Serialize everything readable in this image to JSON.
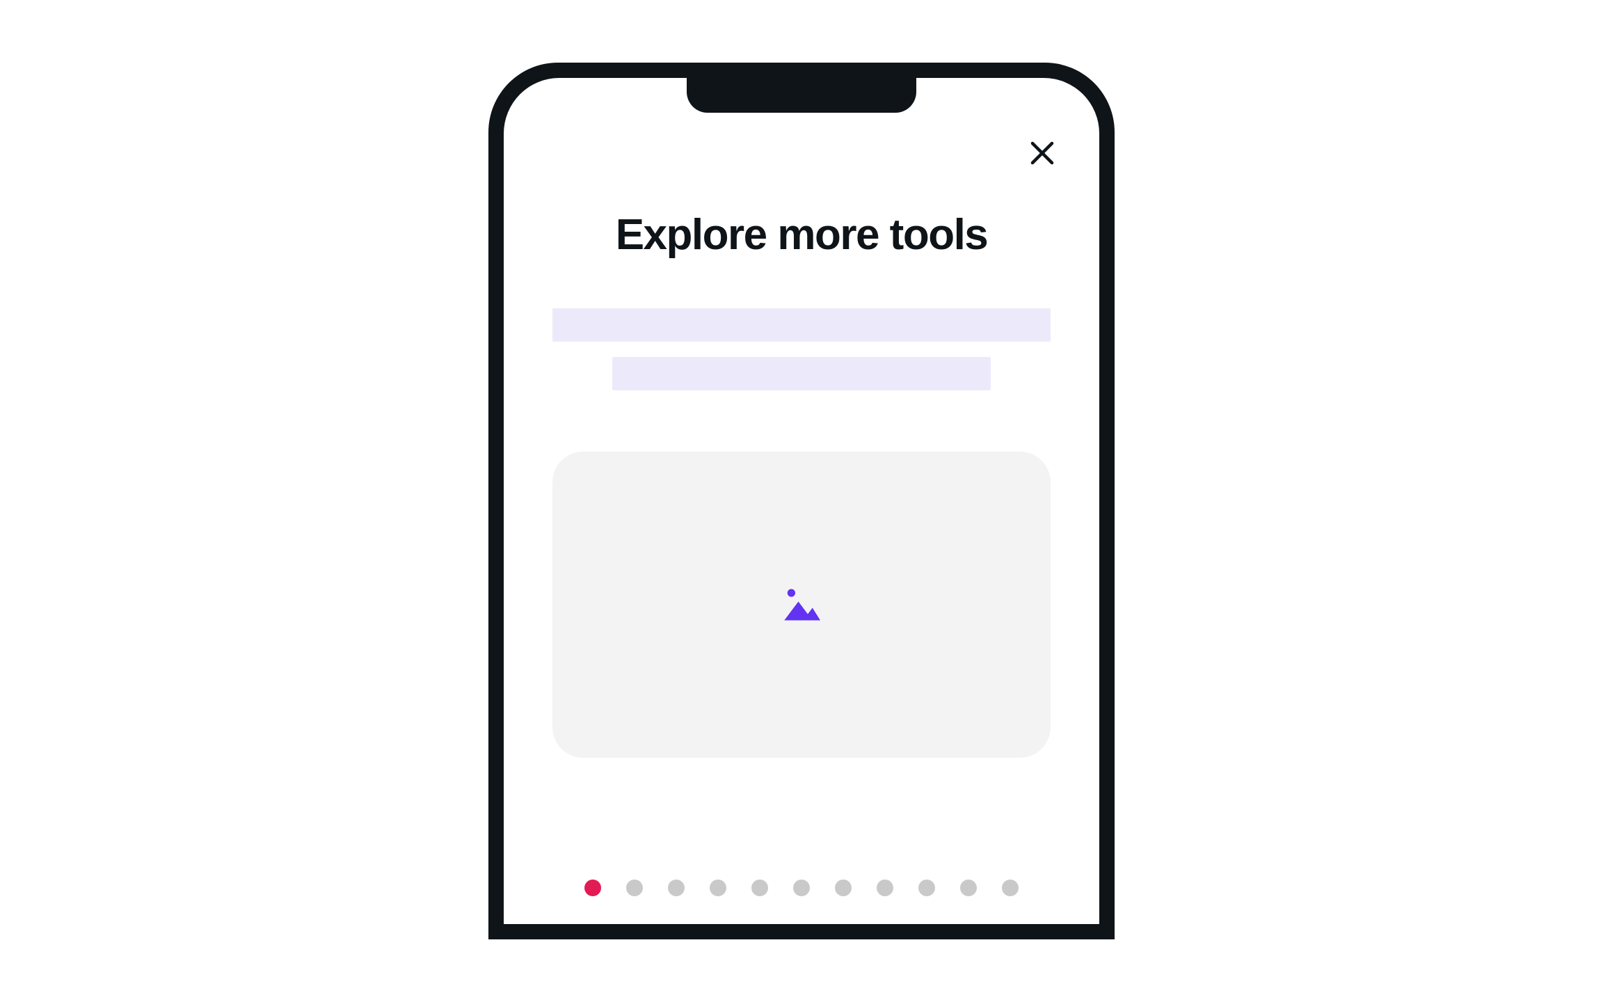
{
  "screen": {
    "title": "Explore more tools"
  },
  "icons": {
    "close": "close-icon",
    "image_placeholder": "image-icon"
  },
  "colors": {
    "accent_purple": "#6233f2",
    "accent_pink": "#e31b54",
    "placeholder_lavender": "#eceafa",
    "card_background": "#f3f3f3",
    "dot_inactive": "#c9c9c9"
  },
  "pagination": {
    "total": 11,
    "active_index": 0
  }
}
